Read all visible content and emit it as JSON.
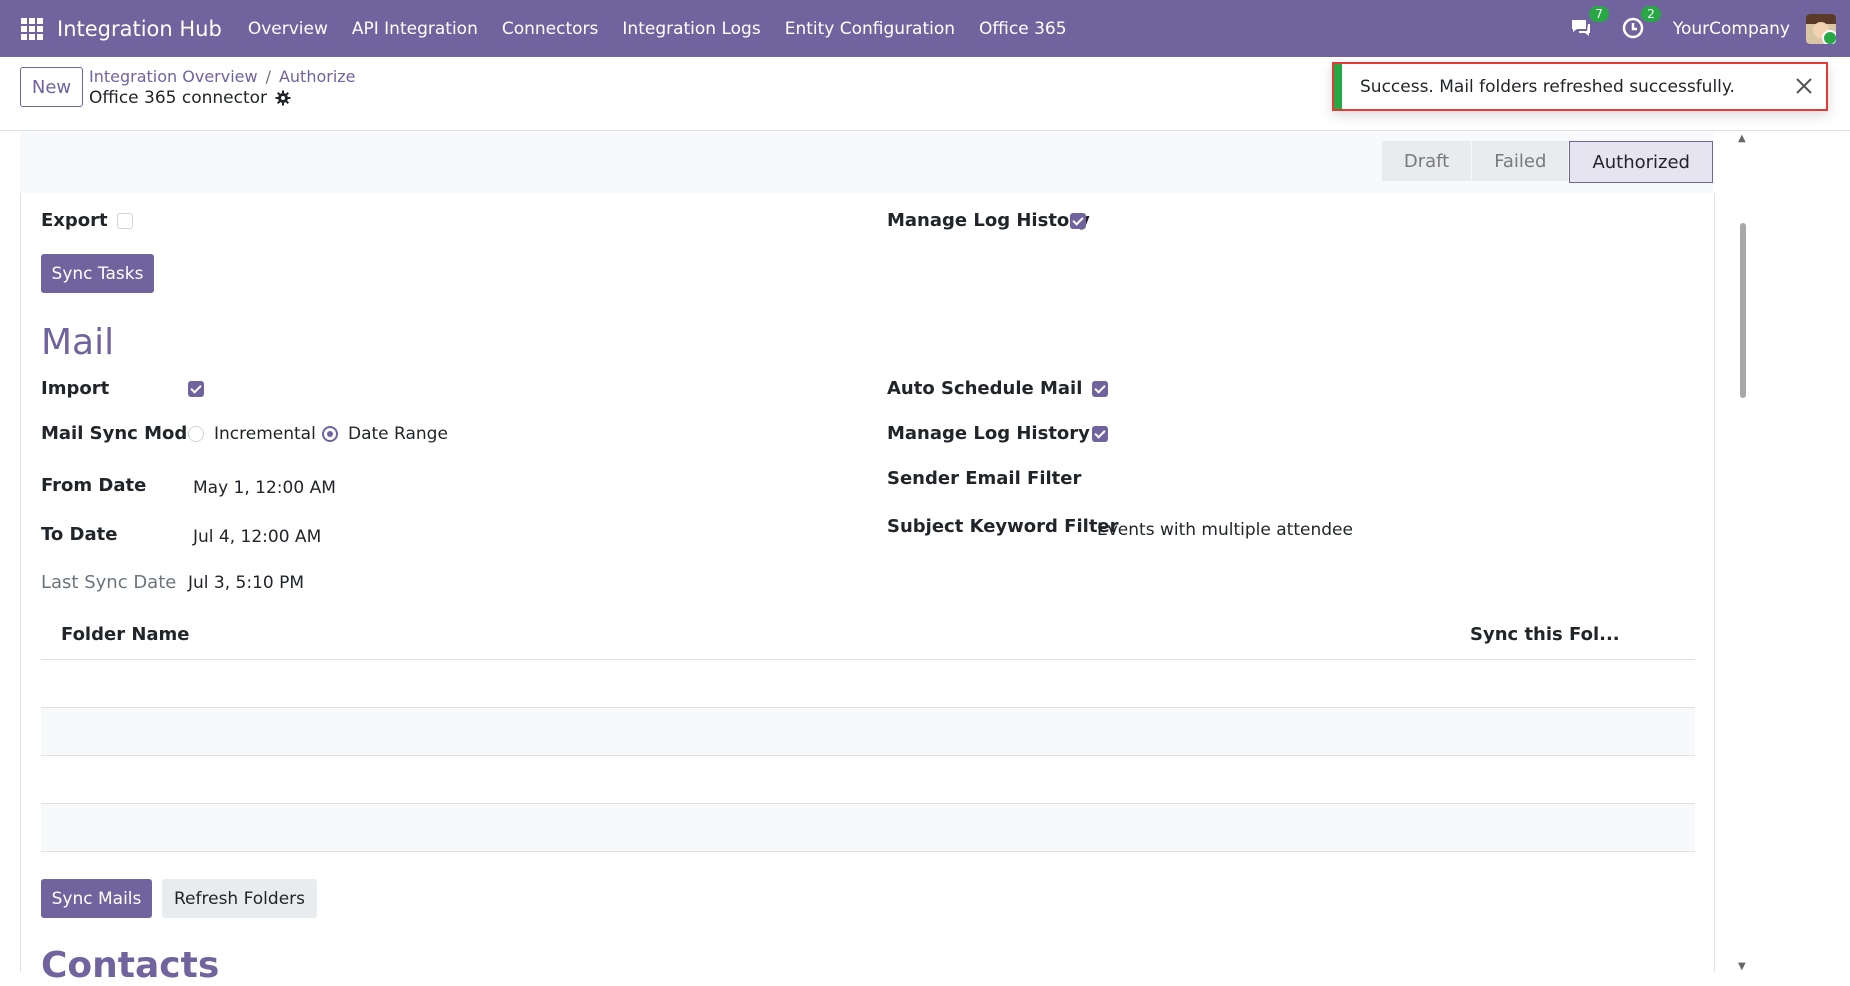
{
  "topbar": {
    "brand": "Integration Hub",
    "nav": [
      "Overview",
      "API Integration",
      "Connectors",
      "Integration Logs",
      "Entity Configuration",
      "Office 365"
    ],
    "messages_count": "7",
    "activities_count": "2",
    "company": "YourCompany"
  },
  "control_panel": {
    "new_label": "New",
    "breadcrumb": [
      "Integration Overview",
      "Authorize"
    ],
    "record_title": "Office 365 connector"
  },
  "toast": {
    "message": "Success. Mail folders refreshed successfully."
  },
  "status": {
    "stages": [
      "Draft",
      "Failed",
      "Authorized"
    ],
    "active": "Authorized"
  },
  "tasks": {
    "export_label": "Export",
    "export_checked": false,
    "manage_log_label": "Manage Log History",
    "manage_log_checked": true,
    "sync_button": "Sync Tasks"
  },
  "mail": {
    "title": "Mail",
    "import_label": "Import",
    "import_checked": true,
    "sync_mode_label": "Mail Sync Mode",
    "sync_mode_options": [
      "Incremental",
      "Date Range"
    ],
    "sync_mode_selected": "Date Range",
    "from_date_label": "From Date",
    "from_date": "May 1, 12:00 AM",
    "to_date_label": "To Date",
    "to_date": "Jul 4, 12:00 AM",
    "last_sync_label": "Last Sync Date",
    "last_sync": "Jul 3, 5:10 PM",
    "auto_schedule_label": "Auto Schedule Mail",
    "auto_schedule_checked": true,
    "manage_log_label": "Manage Log History",
    "manage_log_checked": true,
    "sender_filter_label": "Sender Email Filter",
    "sender_filter": "",
    "subject_filter_label": "Subject Keyword Filter",
    "subject_filter": "Events with multiple attendee",
    "table_headers": [
      "Folder Name",
      "Sync this Fol..."
    ],
    "sync_button": "Sync Mails",
    "refresh_button": "Refresh Folders"
  },
  "contacts": {
    "title": "Contacts"
  }
}
